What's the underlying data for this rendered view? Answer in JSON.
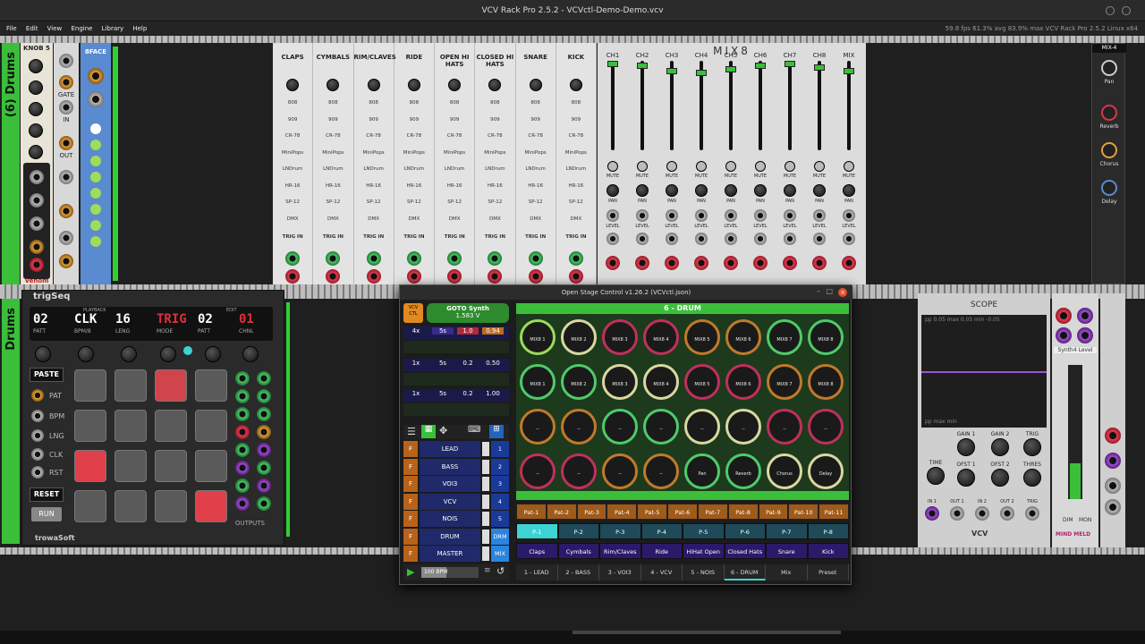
{
  "window": {
    "title": "VCV Rack Pro 2.5.2 - VCVctl-Demo-Demo.vcv"
  },
  "menu": {
    "items": [
      "File",
      "Edit",
      "View",
      "Engine",
      "Library",
      "Help"
    ],
    "stats": "59.8 fps  61.3% avg  83.9% max     VCV Rack Pro 2.5.2 Linux x64"
  },
  "rack": {
    "row1_label": "(6) Drums",
    "row2_label": "Drums",
    "knob5": "KNOB 5",
    "eightface": "8FACE",
    "venom": "Venom",
    "gate": "GATE",
    "in": "IN",
    "out": "OUT",
    "drums": [
      "CLAPS",
      "CYMBALS",
      "RIM/CLAVES",
      "RIDE",
      "OPEN HI HATS",
      "CLOSED HI HATS",
      "SNARE",
      "KICK"
    ],
    "drum_opts": [
      "808",
      "909",
      "CR-78",
      "MiniPops",
      "LNDrum",
      "HR-16",
      "SP-12",
      "DMX"
    ],
    "trig": "TRIG IN",
    "outl": "OUT",
    "mix8": "MIX8",
    "mix_ch": [
      "CH1",
      "CH2",
      "CH3",
      "CH4",
      "CH5",
      "CH6",
      "CH7",
      "CH8",
      "MIX"
    ],
    "mute": "MUTE",
    "pan": "PAN",
    "level": "LEVEL",
    "mix4": "MIX-4",
    "fx": [
      "Pan",
      "Reverb",
      "Chorus",
      "Delay"
    ],
    "trigseq": "trigSeq",
    "trowasoft": "trowaSoft",
    "playback": "PLAYBACK",
    "edit": "EDIT",
    "seq_display": [
      {
        "v": "02",
        "l": "PATT"
      },
      {
        "v": "CLK",
        "l": "BPM/8"
      },
      {
        "v": "16",
        "l": "LENG"
      },
      {
        "v": "TRIG",
        "l": "MODE"
      },
      {
        "v": "02",
        "l": "PATT"
      },
      {
        "v": "01",
        "l": "CHNL"
      }
    ],
    "side_buttons": [
      "PASTE",
      "PAT",
      "BPM",
      "LNG",
      "CLK",
      "RST",
      "RESET",
      "RUN"
    ],
    "outputs": "OUTPUTS",
    "scope": "SCOPE",
    "scope_stats": "pp  0.05  max  0.05  min  -0.05",
    "scope_stats2": "pp     max     min",
    "scope_ctrls": [
      "TIME",
      "GAIN 1",
      "OFST 1",
      "GAIN 2",
      "OFST 2",
      "THRES",
      "TRIG"
    ],
    "scope_io": [
      "IN 1",
      "OUT 1",
      "IN 2",
      "OUT 2",
      "TRIG"
    ],
    "vcv": "VCV",
    "synth4": "Synth4 Level",
    "mindmeld": "MIND MELD",
    "dim": "DIM",
    "mon": "MON"
  },
  "osc": {
    "title": "Open Stage Control v1.26.2 (VCVctl.json)",
    "goto": "GOTO Synth",
    "voltage": "1.583 V",
    "rows": [
      [
        "4x",
        "5s",
        "1.0",
        "0.94"
      ],
      [
        "1x",
        "5s",
        "0.2",
        "0.50"
      ],
      [
        "1x",
        "5s",
        "0.2",
        "1.00"
      ]
    ],
    "channels": [
      {
        "name": "LEAD",
        "num": "1"
      },
      {
        "name": "BASS",
        "num": "2"
      },
      {
        "name": "VOI3",
        "num": "3"
      },
      {
        "name": "VCV",
        "num": "4"
      },
      {
        "name": "NOIS",
        "num": "5"
      },
      {
        "name": "DRUM",
        "num": "DRM"
      },
      {
        "name": "MASTER",
        "num": "MIX"
      }
    ],
    "fbtn": "F",
    "bpm": "100 BPM",
    "panel_title": "6 - DRUM",
    "knobs_row1": [
      "MIX8 1",
      "MIX8 2",
      "MIX8 3",
      "MIX8 4",
      "MIX8 5",
      "MIX8 6",
      "MIX8 7",
      "MIX8 8"
    ],
    "knobs_row2": [
      "MIX8 1 panning",
      "MIX8 2 panning",
      "MIX8 3 panning",
      "MIX8 4 panning",
      "MIX8 5 panning",
      "MIX8 6 panning",
      "MIX8 7 panning",
      "MIX8 8 panning"
    ],
    "knobs_row3": [
      "--",
      "--",
      "--",
      "--",
      "--",
      "--",
      "--",
      "--"
    ],
    "knobs_row4": [
      "--",
      "--",
      "--",
      "--",
      "Pan",
      "Reverb",
      "Chorus",
      "Delay"
    ],
    "patterns": [
      "Pat-1",
      "Pat-2",
      "Pat-3",
      "Pat-4",
      "Pat-5",
      "Pat-6",
      "Pat-7",
      "Pat-8",
      "Pat-9",
      "Pat-10",
      "Pat-11"
    ],
    "presets": [
      "P-1",
      "P-2",
      "P-3",
      "P-4",
      "P-5",
      "P-6",
      "P-7",
      "P-8"
    ],
    "drum_names": [
      "Claps",
      "Cymbals",
      "Rim/Claves",
      "Ride",
      "HiHat Open",
      "Closed Hats",
      "Snare",
      "Kick"
    ],
    "tabs": [
      "1 - LEAD",
      "2 - BASS",
      "3 - VOI3",
      "4 - VCV",
      "5 - NOIS",
      "6 - DRUM",
      "Mix",
      "Preset"
    ]
  },
  "colors": {
    "accent_green": "#3bbf3b",
    "orange": "#b8621a",
    "red": "#d33a4a",
    "blue": "#2264c0",
    "teal": "#3dd3d3"
  }
}
